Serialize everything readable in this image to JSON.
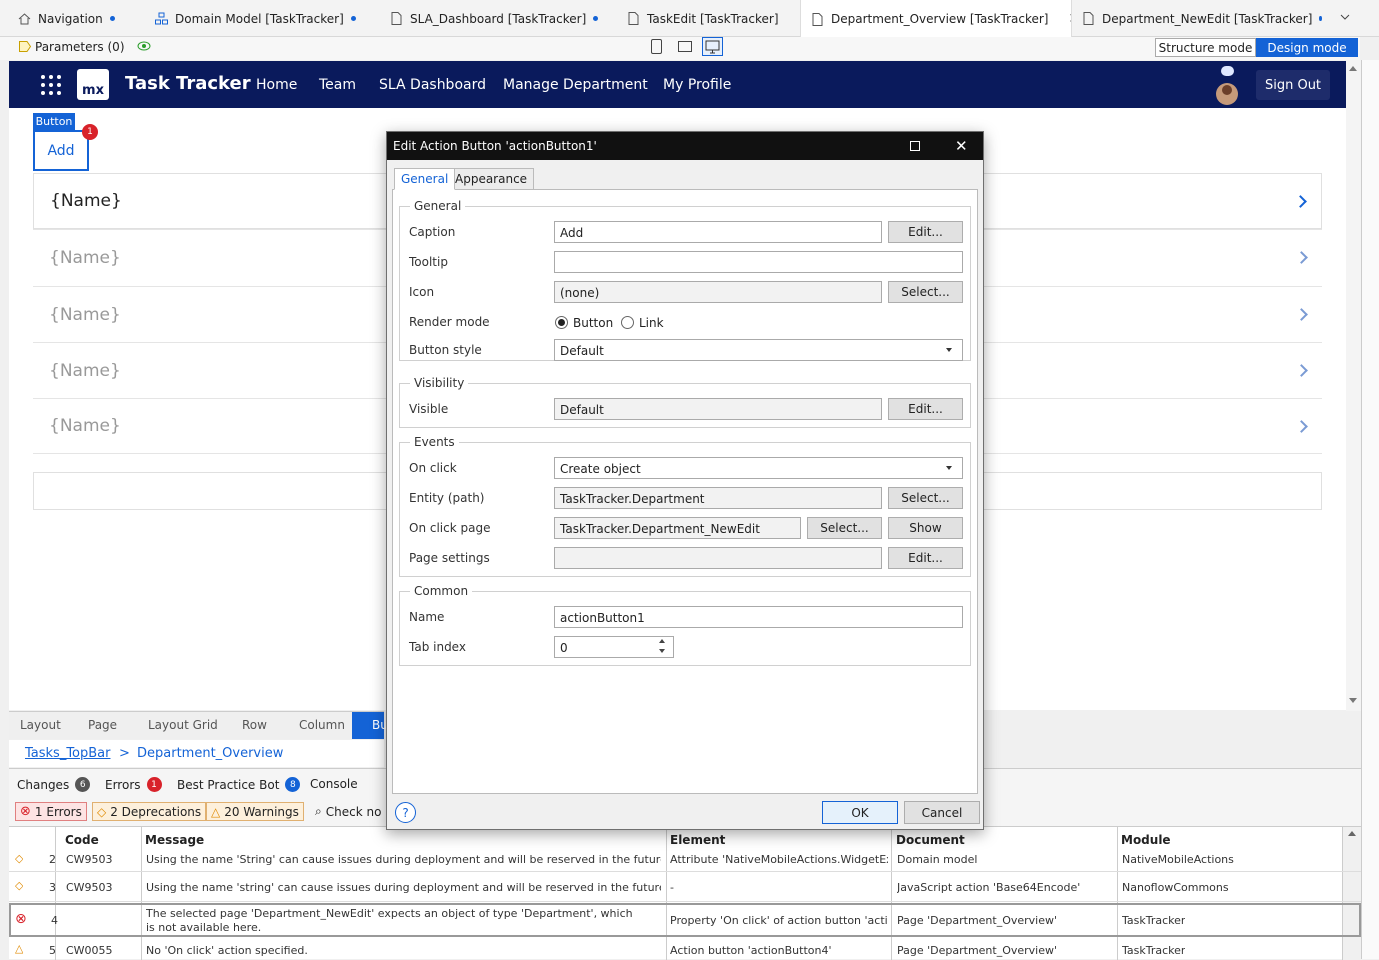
{
  "tabs": [
    {
      "label": "Navigation",
      "dot": true
    },
    {
      "label": "Domain Model [TaskTracker]",
      "dot": true
    },
    {
      "label": "SLA_Dashboard [TaskTracker]",
      "dot": true
    },
    {
      "label": "TaskEdit [TaskTracker]",
      "dot": false
    },
    {
      "label": "Department_Overview [TaskTracker]",
      "dot": true
    },
    {
      "label": "Department_NewEdit [TaskTracker]",
      "dot": true
    }
  ],
  "toolbar": {
    "parameters": "Parameters (0)",
    "structure_mode": "Structure mode",
    "design_mode": "Design mode"
  },
  "app": {
    "logo": "mx",
    "title": "Task Tracker",
    "nav": [
      "Home",
      "Team",
      "SLA Dashboard",
      "Manage Department",
      "My Profile"
    ],
    "sign_out": "Sign Out"
  },
  "canvas": {
    "widget_tag": "Button",
    "add_label": "Add",
    "error_count": "1",
    "rows": [
      "{Name}",
      "{Name}",
      "{Name}",
      "{Name}",
      "{Name}"
    ]
  },
  "breadcrumb": [
    "Layout",
    "Page",
    "Layout Grid",
    "Row",
    "Column",
    "Bu"
  ],
  "path": {
    "layout": "Tasks_TopBar",
    "sep": ">",
    "page": "Department_Overview"
  },
  "bottom_tabs": {
    "changes": "Changes",
    "changes_count": "6",
    "errors": "Errors",
    "errors_count": "1",
    "bot": "Best Practice Bot",
    "bot_count": "8",
    "console": "Console"
  },
  "filters": {
    "errors": "1 Errors",
    "deprecations": "2 Deprecations",
    "warnings": "20 Warnings",
    "check": "Check no"
  },
  "grid": {
    "headers": [
      "Code",
      "Message",
      "Element",
      "Document",
      "Module"
    ],
    "rows": [
      {
        "num": "2",
        "code": "CW9503",
        "message": "Using the name 'String' can cause issues during deployment and will be reserved in the future.",
        "element": "Attribute 'NativeMobileActions.WidgetEx...",
        "document": "Domain model",
        "module": "NativeMobileActions"
      },
      {
        "num": "3",
        "code": "CW9503",
        "message": "Using the name 'string' can cause issues during deployment and will be reserved in the future.",
        "element": "-",
        "document": "JavaScript action 'Base64Encode'",
        "module": "NanoflowCommons"
      },
      {
        "num": "4",
        "code": "",
        "message": "The selected page 'Department_NewEdit' expects an object of type 'Department', which is not available here.",
        "element": "Property 'On click' of action button 'actio...",
        "document": "Page 'Department_Overview'",
        "module": "TaskTracker"
      },
      {
        "num": "5",
        "code": "CW0055",
        "message": "No 'On click' action specified.",
        "element": "Action button 'actionButton4'",
        "document": "Page 'Department_Overview'",
        "module": "TaskTracker"
      }
    ]
  },
  "dialog": {
    "title": "Edit Action Button 'actionButton1'",
    "tabs": [
      "General",
      "Appearance"
    ],
    "groups": {
      "general": "General",
      "visibility": "Visibility",
      "events": "Events",
      "common": "Common"
    },
    "labels": {
      "caption": "Caption",
      "tooltip": "Tooltip",
      "icon": "Icon",
      "render_mode": "Render mode",
      "button_style": "Button style",
      "visible": "Visible",
      "on_click": "On click",
      "entity": "Entity (path)",
      "on_click_page": "On click page",
      "page_settings": "Page settings",
      "name": "Name",
      "tab_index": "Tab index"
    },
    "values": {
      "caption": "Add",
      "tooltip": "",
      "icon": "(none)",
      "render_button": "Button",
      "render_link": "Link",
      "button_style": "Default",
      "visible": "Default",
      "on_click": "Create object",
      "entity": "TaskTracker.Department",
      "on_click_page": "TaskTracker.Department_NewEdit",
      "page_settings": "",
      "name": "actionButton1",
      "tab_index": "0"
    },
    "buttons": {
      "edit": "Edit...",
      "select": "Select...",
      "show": "Show",
      "ok": "OK",
      "cancel": "Cancel",
      "help": "?"
    }
  }
}
